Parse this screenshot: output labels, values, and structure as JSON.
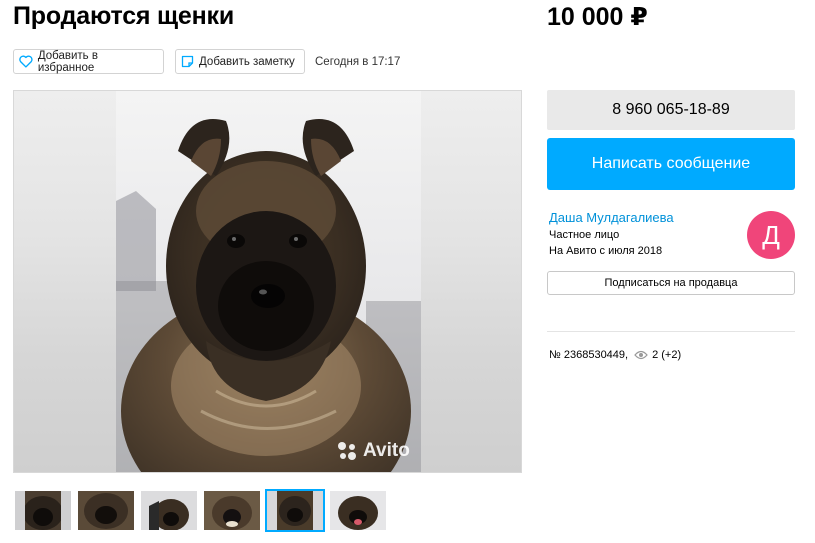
{
  "listing": {
    "title": "Продаются щенки",
    "price": "10 000 ₽",
    "posted": "Сегодня в 17:17"
  },
  "actions": {
    "favorite_label": "Добавить в избранное",
    "note_label": "Добавить заметку"
  },
  "gallery": {
    "watermark": "Avito",
    "thumbnail_count": 6,
    "active_thumbnail": 5
  },
  "contact": {
    "phone": "8 960 065-18-89",
    "message_label": "Написать сообщение"
  },
  "seller": {
    "name": "Даша Мулдагалиева",
    "type": "Частное лицо",
    "since": "На Авито с июля 2018",
    "avatar_letter": "Д",
    "subscribe_label": "Подписаться на продавца"
  },
  "stats": {
    "item_number": "№ 2368530449,",
    "views": "2 (+2)"
  },
  "colors": {
    "accent": "#00aaff",
    "link": "#0091d9",
    "avatar": "#f0457a"
  }
}
